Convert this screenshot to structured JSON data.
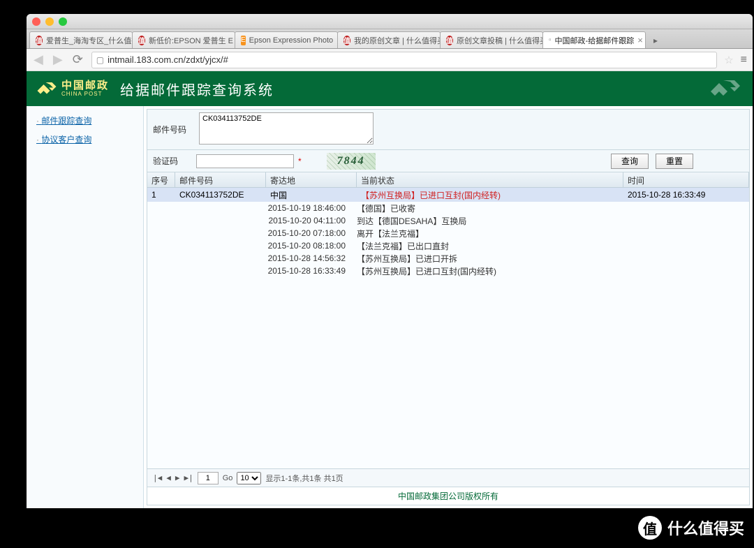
{
  "browser": {
    "url": "intmail.183.com.cn/zdxt/yjcx/#",
    "tabs": [
      {
        "label": "爱普生_海淘专区_什么值得买",
        "icon": "red",
        "active": false
      },
      {
        "label": "新低价:EPSON 爱普生 E",
        "icon": "red",
        "active": false
      },
      {
        "label": "Epson Expression Photo",
        "icon": "orange",
        "active": false
      },
      {
        "label": "我的原创文章 | 什么值得买",
        "icon": "red",
        "active": false
      },
      {
        "label": "原创文章投稿 | 什么值得买",
        "icon": "red",
        "active": false
      },
      {
        "label": "中国邮政-给据邮件跟踪",
        "icon": "doc",
        "active": true
      }
    ]
  },
  "banner": {
    "brand_cn": "中国邮政",
    "brand_en": "CHINA POST",
    "title": "给据邮件跟踪查询系统"
  },
  "sidebar": {
    "links": [
      "邮件跟踪查询",
      "协议客户查询"
    ]
  },
  "form": {
    "mail_label": "邮件号码",
    "mail_value": "CK034113752DE",
    "captcha_label": "验证码",
    "captcha_text": "7844",
    "query_btn": "查询",
    "reset_btn": "重置"
  },
  "grid": {
    "headers": {
      "seq": "序号",
      "mail": "邮件号码",
      "dest": "寄达地",
      "status": "当前状态",
      "time": "时间"
    },
    "row": {
      "seq": "1",
      "mail": "CK034113752DE",
      "dest": "中国",
      "status": "【苏州互换局】已进口互封(国内经转)",
      "time": "2015-10-28 16:33:49"
    },
    "details": [
      {
        "t": "2015-10-19 18:46:00",
        "d": "【德国】已收寄"
      },
      {
        "t": "2015-10-20 04:11:00",
        "d": "到达【德国DESAHA】互换局"
      },
      {
        "t": "2015-10-20 07:18:00",
        "d": "离开【法兰克福】"
      },
      {
        "t": "2015-10-20 08:18:00",
        "d": "【法兰克福】已出口直封"
      },
      {
        "t": "2015-10-28 14:56:32",
        "d": "【苏州互换局】已进口开拆"
      },
      {
        "t": "2015-10-28 16:33:49",
        "d": "【苏州互换局】已进口互封(国内经转)"
      }
    ]
  },
  "pager": {
    "page": "1",
    "go": "Go",
    "size": "10",
    "info": "显示1-1条,共1条 共1页"
  },
  "footer": "中国邮政集团公司版权所有",
  "watermark": "什么值得买",
  "watermark_badge": "值"
}
